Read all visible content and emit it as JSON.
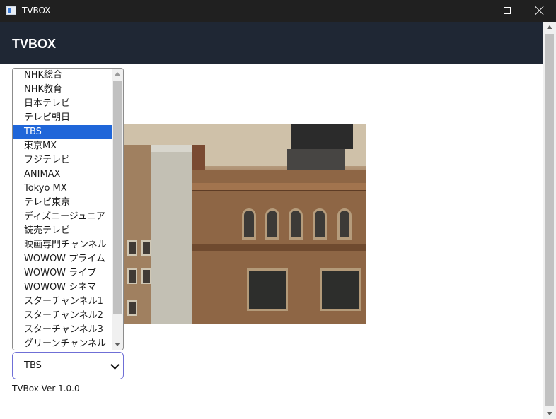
{
  "window": {
    "title": "TVBOX",
    "controls": [
      "minimize",
      "maximize",
      "close"
    ]
  },
  "header": {
    "brand": "TVBOX"
  },
  "channel_select": {
    "selected": "TBS",
    "selected_index": 4,
    "options": [
      "NHK総合",
      "NHK教育",
      "日本テレビ",
      "テレビ朝日",
      "TBS",
      "東京MX",
      "フジテレビ",
      "ANIMAX",
      "Tokyo MX",
      "テレビ東京",
      "ディズニージュニア",
      "読売テレビ",
      "映画専門チャンネル",
      "WOWOW プライム",
      "WOWOW ライブ",
      "WOWOW シネマ",
      "スターチャンネル1",
      "スターチャンネル2",
      "スターチャンネル3",
      "グリーンチャンネル"
    ]
  },
  "footer": {
    "version": "TVBox Ver 1.0.0"
  },
  "icons": {
    "app": "tv-app-icon",
    "minimize": "minimize-icon",
    "maximize": "maximize-icon",
    "close": "close-icon",
    "select_chevron": "chevron-down-icon"
  },
  "colors": {
    "titlebar": "#202020",
    "header": "#1f2734",
    "selection": "#1f66d9",
    "select_border": "#6f6fd6"
  }
}
